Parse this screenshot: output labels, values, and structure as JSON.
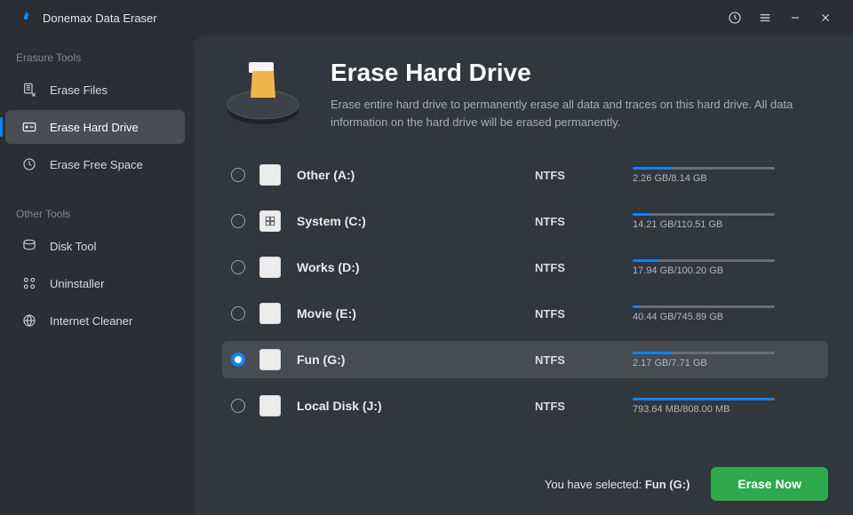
{
  "app": {
    "title": "Donemax Data Eraser"
  },
  "sidebar": {
    "sections": [
      {
        "label": "Erasure Tools",
        "items": [
          {
            "label": "Erase Files",
            "active": false
          },
          {
            "label": "Erase Hard Drive",
            "active": true
          },
          {
            "label": "Erase Free Space",
            "active": false
          }
        ]
      },
      {
        "label": "Other Tools",
        "items": [
          {
            "label": "Disk Tool",
            "active": false
          },
          {
            "label": "Uninstaller",
            "active": false
          },
          {
            "label": "Internet Cleaner",
            "active": false
          }
        ]
      }
    ]
  },
  "hero": {
    "title": "Erase Hard Drive",
    "desc": "Erase entire hard drive to permanently erase all data and traces on this hard drive. All data information on the hard drive will be erased permanently."
  },
  "drives": [
    {
      "name": "Other (A:)",
      "fs": "NTFS",
      "sizes": "2.26 GB/8.14 GB",
      "pct": 28,
      "sys": false,
      "selected": false
    },
    {
      "name": "System (C:)",
      "fs": "NTFS",
      "sizes": "14.21 GB/110.51 GB",
      "pct": 13,
      "sys": true,
      "selected": false
    },
    {
      "name": "Works (D:)",
      "fs": "NTFS",
      "sizes": "17.94 GB/100.20 GB",
      "pct": 18,
      "sys": false,
      "selected": false
    },
    {
      "name": "Movie (E:)",
      "fs": "NTFS",
      "sizes": "40.44 GB/745.89 GB",
      "pct": 5,
      "sys": false,
      "selected": false
    },
    {
      "name": "Fun (G:)",
      "fs": "NTFS",
      "sizes": "2.17 GB/7.71 GB",
      "pct": 28,
      "sys": false,
      "selected": true
    },
    {
      "name": "Local Disk (J:)",
      "fs": "NTFS",
      "sizes": "793.64 MB/808.00 MB",
      "pct": 98,
      "sys": false,
      "selected": false
    }
  ],
  "footer": {
    "status_prefix": "You have selected: ",
    "selected_name": "Fun (G:)",
    "button": "Erase Now"
  }
}
